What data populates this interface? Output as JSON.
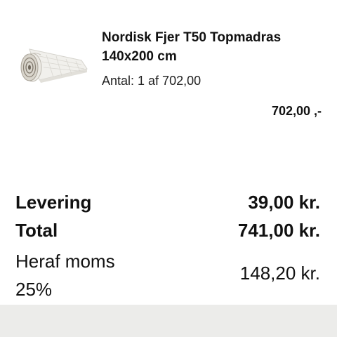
{
  "product": {
    "name": "Nordisk Fjer T50 Topmadras 140x200 cm",
    "quantity_text": "Antal: 1 af 702,00",
    "price": "702,00 ,-",
    "image_icon": "rolled-mattress-topper-image"
  },
  "summary": {
    "delivery_label": "Levering",
    "delivery_value": "39,00 kr.",
    "total_label": "Total",
    "total_value": "741,00 kr.",
    "vat_label": "Heraf moms 25%",
    "vat_value": "148,20 kr."
  }
}
